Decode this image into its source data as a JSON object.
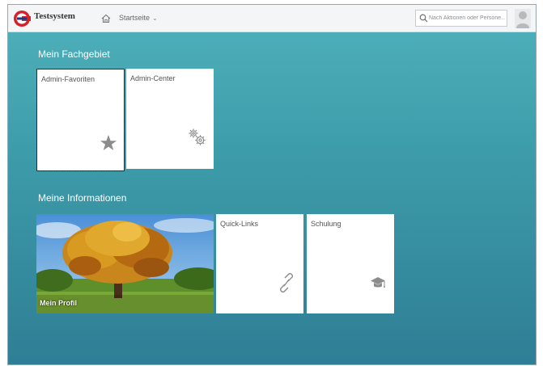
{
  "header": {
    "app_title": "Testsystem",
    "nav_label": "Startseite",
    "search_placeholder": "Nach Aktionen oder Persone..."
  },
  "sections": [
    {
      "title": "Mein Fachgebiet",
      "tiles": [
        {
          "label": "Admin-Favoriten",
          "icon": "star-icon"
        },
        {
          "label": "Admin-Center",
          "icon": "gears-icon"
        }
      ]
    },
    {
      "title": "Meine Informationen",
      "tiles": [
        {
          "label": "Mein Profil",
          "icon": "tree-photo"
        },
        {
          "label": "Quick-Links",
          "icon": "link-icon"
        },
        {
          "label": "Schulung",
          "icon": "graduation-cap-icon"
        }
      ]
    }
  ],
  "colors": {
    "background_top": "#4fb2bb",
    "background_bottom": "#2f7e95",
    "logo_red": "#d6202a"
  }
}
